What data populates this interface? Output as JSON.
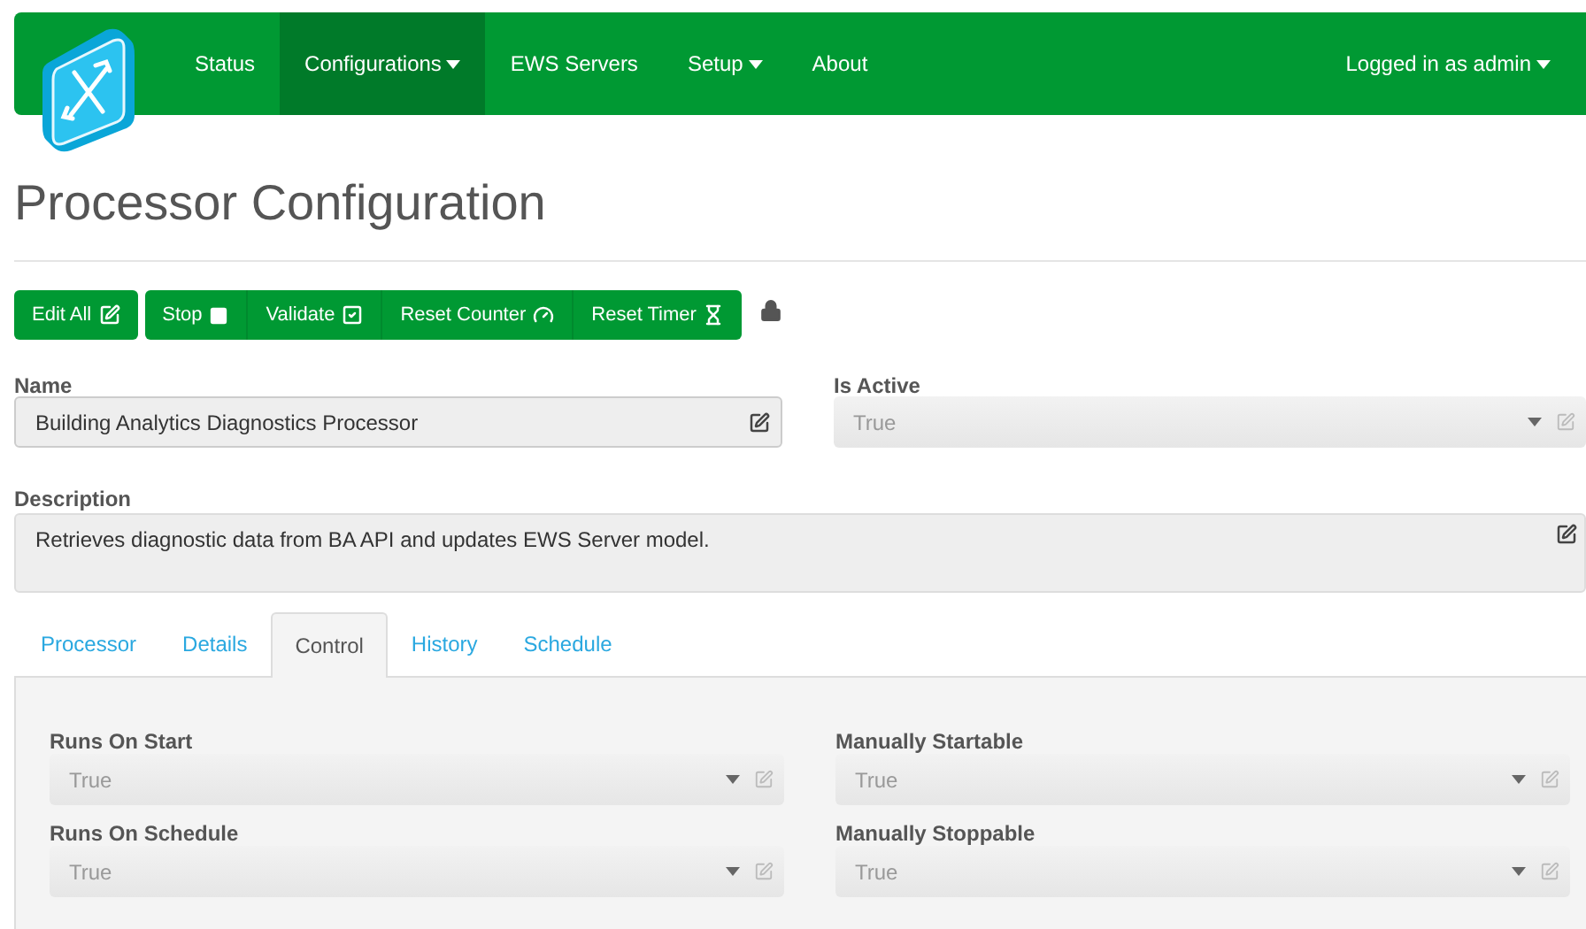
{
  "navbar": {
    "items": [
      {
        "label": "Status",
        "selected": false,
        "dropdown": false
      },
      {
        "label": "Configurations",
        "selected": true,
        "dropdown": true
      },
      {
        "label": "EWS Servers",
        "selected": false,
        "dropdown": false
      },
      {
        "label": "Setup",
        "selected": false,
        "dropdown": true
      },
      {
        "label": "About",
        "selected": false,
        "dropdown": false
      }
    ],
    "user": {
      "label": "Logged in as admin",
      "dropdown": true
    }
  },
  "page_title": "Processor Configuration",
  "toolbar": {
    "groups": [
      [
        {
          "label": "Edit All",
          "kind": "edit"
        }
      ],
      [
        {
          "label": "Stop",
          "kind": "stop"
        },
        {
          "label": "Validate",
          "kind": "check"
        },
        {
          "label": "Reset Counter",
          "kind": "counter"
        },
        {
          "label": "Reset Timer",
          "kind": "timer"
        }
      ]
    ],
    "locked": true
  },
  "fields": [
    {
      "label": "Name",
      "kind": "text",
      "value": "Building Analytics Diagnostics Processor",
      "disabled": false
    },
    {
      "label": "Is Active",
      "kind": "select",
      "value": "True",
      "disabled": true
    }
  ],
  "description": {
    "label": "Description",
    "value": "Retrieves diagnostic data from BA API and updates EWS Server model."
  },
  "tabs": [
    {
      "label": "Processor",
      "selected": false
    },
    {
      "label": "Details",
      "selected": false
    },
    {
      "label": "Control",
      "selected": true
    },
    {
      "label": "History",
      "selected": false
    },
    {
      "label": "Schedule",
      "selected": false
    }
  ],
  "control_fields": [
    {
      "label": "Runs On Start",
      "value": "True",
      "disabled": true
    },
    {
      "label": "Manually Startable",
      "value": "True",
      "disabled": true
    },
    {
      "label": "Runs On Schedule",
      "value": "True",
      "disabled": true
    },
    {
      "label": "Manually Stoppable",
      "value": "True",
      "disabled": true
    }
  ]
}
